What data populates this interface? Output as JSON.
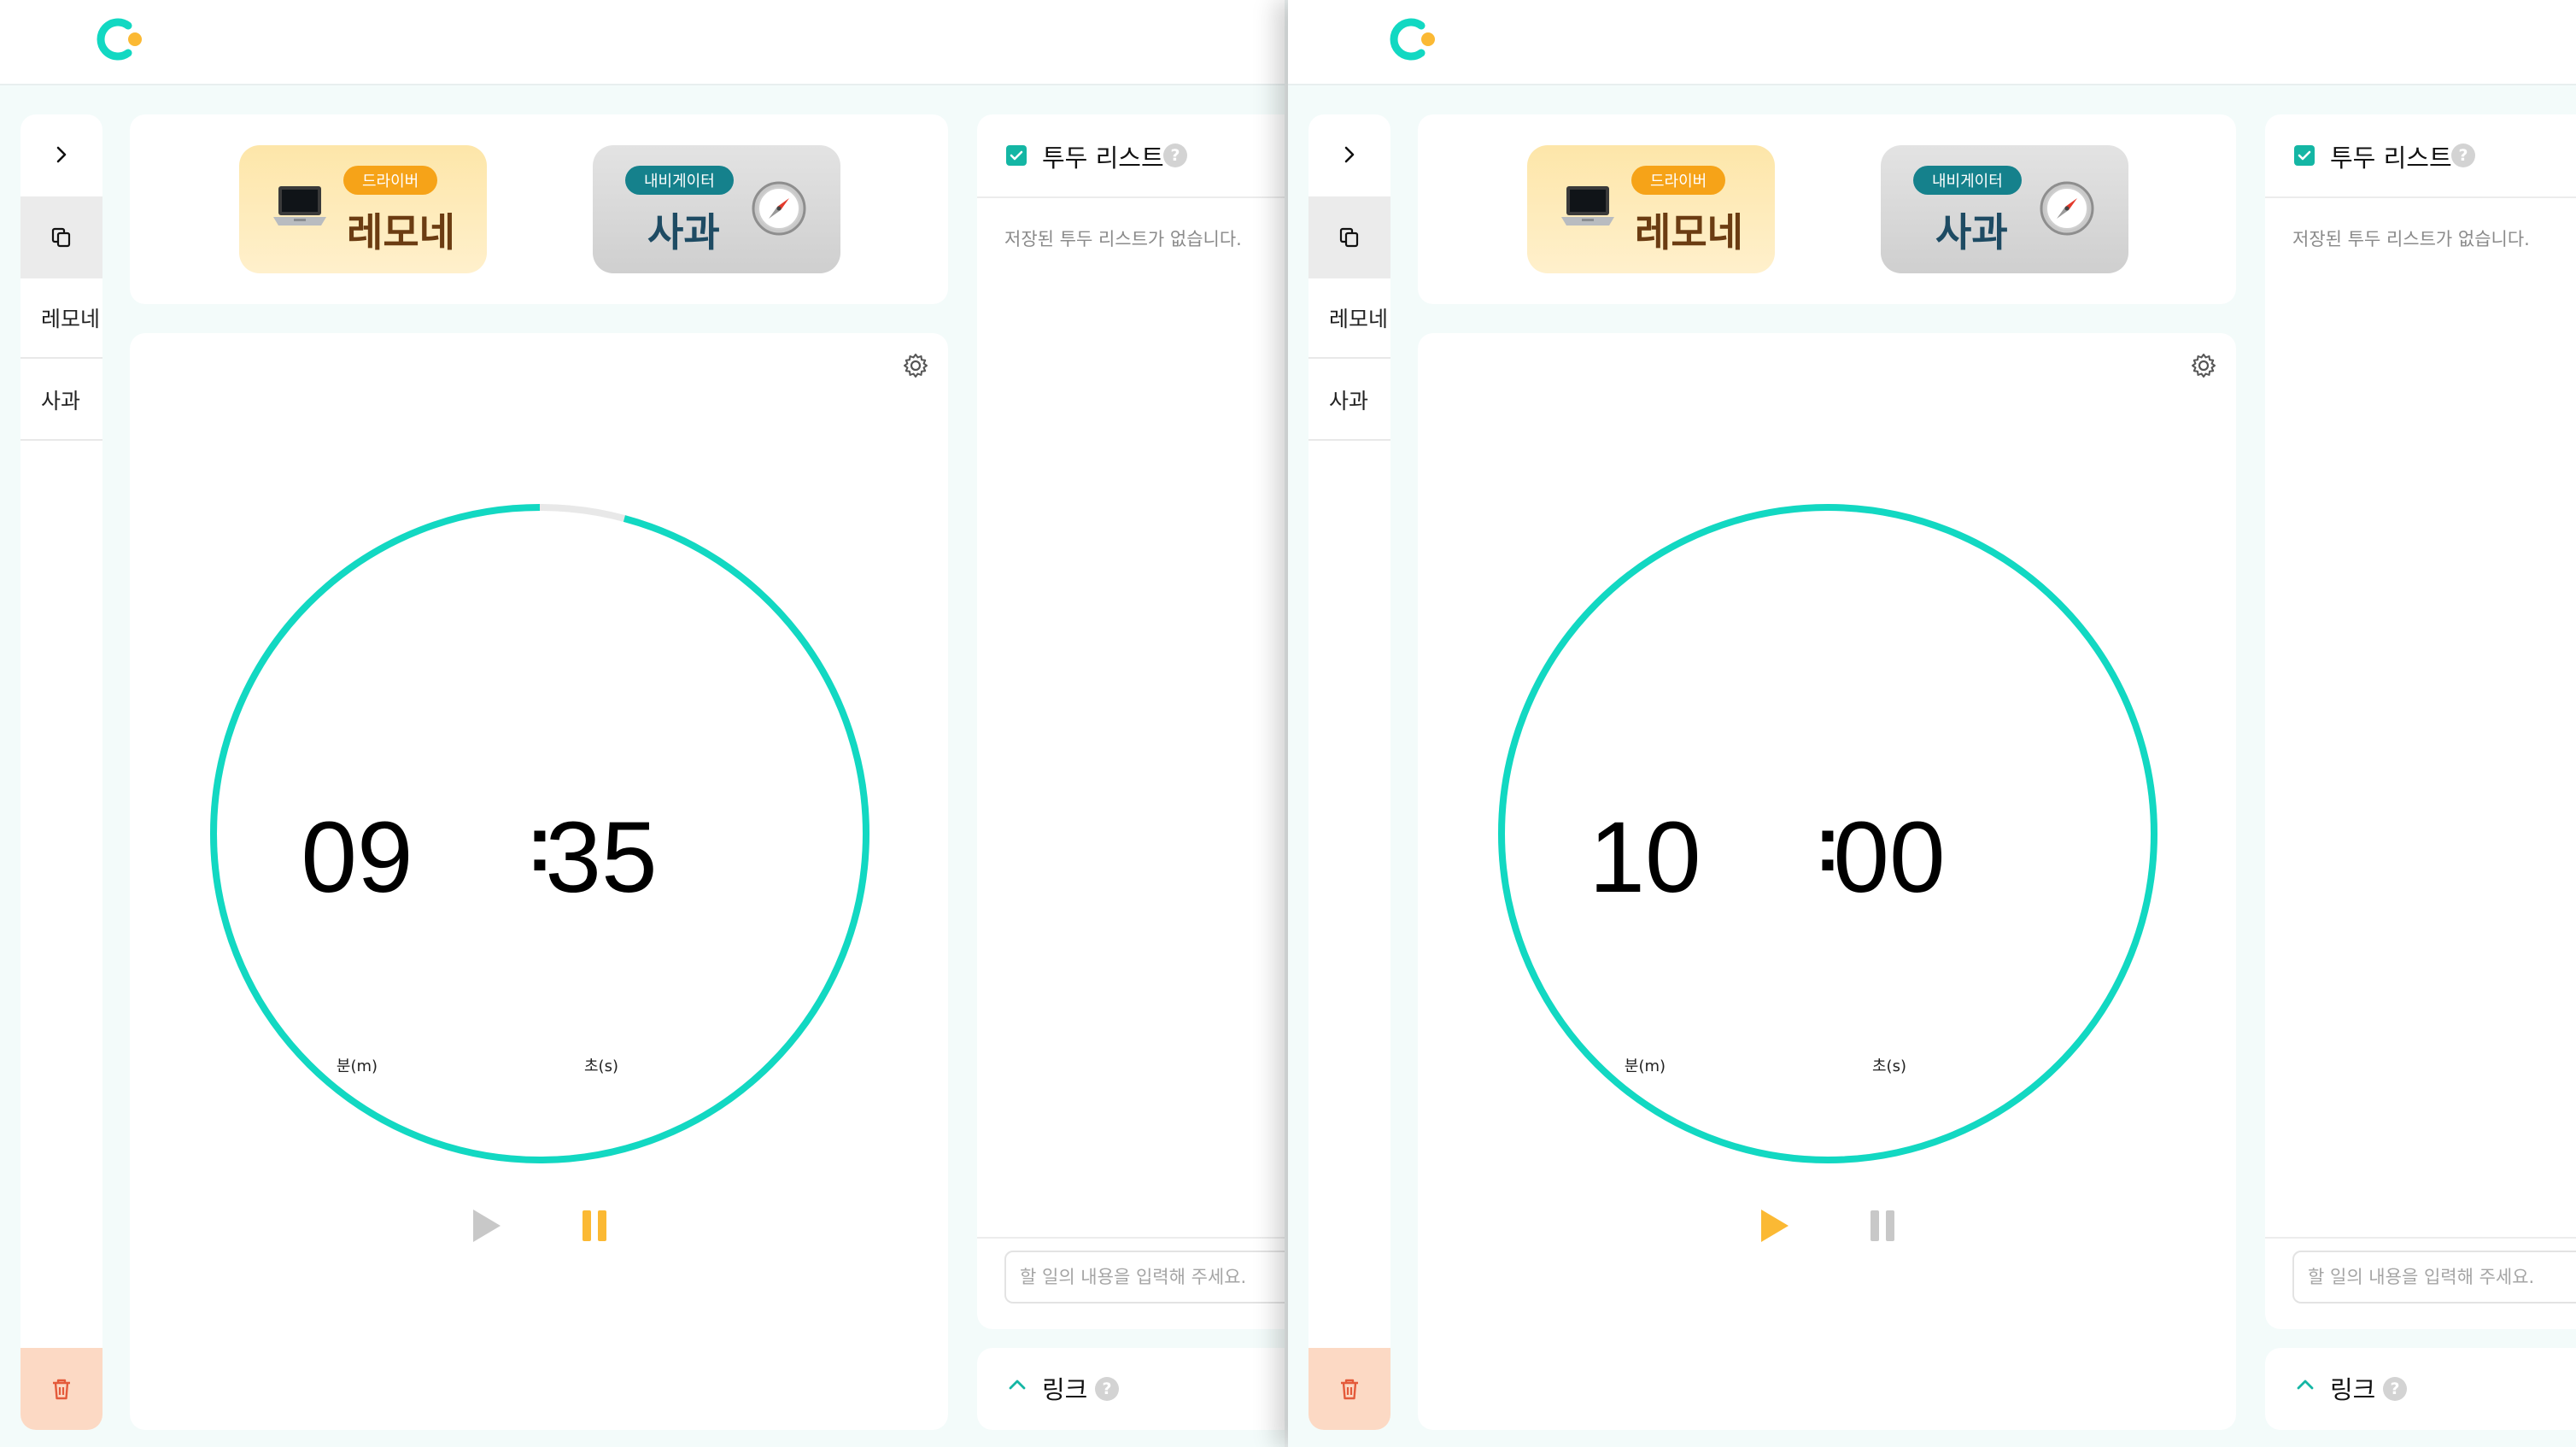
{
  "colors": {
    "accent": "#12d8c2",
    "track": "#e8e8e8",
    "active_control": "#fbb934",
    "inactive_control": "#c8c8c8",
    "driver_badge": "#f6a318",
    "nav_badge": "#15818c",
    "trash_bg": "#fcd9c4",
    "trash_icon": "#e45a3a"
  },
  "panels": [
    {
      "sidebar": {
        "expand_icon": "chevron-right-icon",
        "copy_icon": "copy-icon",
        "items": [
          {
            "label": "레모네"
          },
          {
            "label": "사과"
          }
        ],
        "trash_icon": "trash-icon"
      },
      "devices": [
        {
          "badge": "드라이버",
          "name": "레모네",
          "icon": "laptop-icon"
        },
        {
          "badge": "내비게이터",
          "name": "사과",
          "icon": "compass-icon"
        }
      ],
      "timer": {
        "minutes": "09",
        "seconds": "35",
        "separator": ":",
        "minutes_unit": "분(m)",
        "seconds_unit": "초(s)",
        "progress_remaining": 0.9583,
        "active_control": "pause"
      },
      "todo": {
        "title": "투두 리스트",
        "empty_text": "저장된 투두 리스트가 없습니다.",
        "input_placeholder": "할 일의 내용을 입력해 주세요."
      },
      "links": {
        "title": "링크"
      }
    },
    {
      "sidebar": {
        "expand_icon": "chevron-right-icon",
        "copy_icon": "copy-icon",
        "items": [
          {
            "label": "레모네"
          },
          {
            "label": "사과"
          }
        ],
        "trash_icon": "trash-icon"
      },
      "devices": [
        {
          "badge": "드라이버",
          "name": "레모네",
          "icon": "laptop-icon"
        },
        {
          "badge": "내비게이터",
          "name": "사과",
          "icon": "compass-icon"
        }
      ],
      "timer": {
        "minutes": "10",
        "seconds": "00",
        "separator": ":",
        "minutes_unit": "분(m)",
        "seconds_unit": "초(s)",
        "progress_remaining": 1.0,
        "active_control": "play"
      },
      "todo": {
        "title": "투두 리스트",
        "empty_text": "저장된 투두 리스트가 없습니다.",
        "input_placeholder": "할 일의 내용을 입력해 주세요."
      },
      "links": {
        "title": "링크"
      }
    }
  ],
  "help_glyph": "?"
}
